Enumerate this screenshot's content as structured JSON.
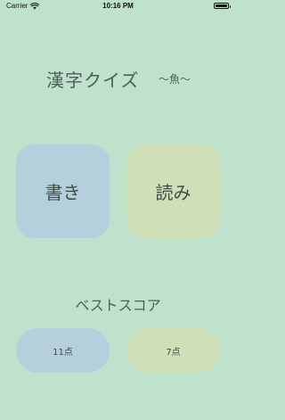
{
  "status_bar": {
    "carrier": "Carrier",
    "time": "10:16 PM"
  },
  "quiz": {
    "title": "漢字クイズ",
    "subtitle": "〜魚〜"
  },
  "modes": {
    "write_label": "書き",
    "read_label": "読み"
  },
  "scores": {
    "label": "ベストスコア",
    "write_score": "11点",
    "read_score": "7点"
  },
  "colors": {
    "background": "#bfe2cd",
    "write_tile": "#b6cfdc",
    "read_tile": "#cfe0b9"
  }
}
